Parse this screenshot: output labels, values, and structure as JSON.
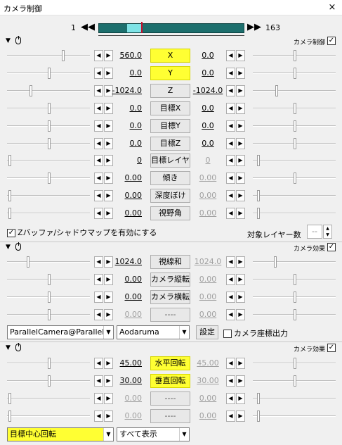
{
  "window": {
    "title": "カメラ制御",
    "close_label": "×"
  },
  "timeline": {
    "start": "1",
    "end": "163",
    "prev_label": "◀◀",
    "next_label": "▶▶"
  },
  "sections": [
    {
      "name": "カメラ制御",
      "checked": "✓"
    },
    {
      "name": "カメラ効果",
      "checked": "✓"
    },
    {
      "name": "カメラ効果",
      "checked": "✓"
    }
  ],
  "camera_control": {
    "params": [
      {
        "left": "560.0",
        "label": "X",
        "right": "0.0"
      },
      {
        "left": "0.0",
        "label": "Y",
        "right": "0.0"
      },
      {
        "left": "-1024.0",
        "label": "Z",
        "right": "-1024.0"
      },
      {
        "left": "0.0",
        "label": "目標X",
        "right": "0.0"
      },
      {
        "left": "0.0",
        "label": "目標Y",
        "right": "0.0"
      },
      {
        "left": "0.0",
        "label": "目標Z",
        "right": "0.0"
      },
      {
        "left": "0",
        "label": "目標レイヤ",
        "right": "0"
      },
      {
        "left": "0.00",
        "label": "傾き",
        "right": "0.00"
      },
      {
        "left": "0.00",
        "label": "深度ぼけ",
        "right": "0.00"
      },
      {
        "left": "0.00",
        "label": "視野角",
        "right": "0.00"
      }
    ],
    "zbuffer_label": "Zバッファ/シャドウマップを有効にする",
    "zbuffer_checked": "✓",
    "target_layer_label": "対象レイヤー数",
    "target_layer_value": "--"
  },
  "camera_effect1": {
    "params": [
      {
        "left": "1024.0",
        "label": "視線和",
        "right": "1024.0"
      },
      {
        "left": "0.00",
        "label": "カメラ縦転",
        "right": "0.00"
      },
      {
        "left": "0.00",
        "label": "カメラ横転",
        "right": "0.00"
      },
      {
        "left": "0.00",
        "label": "----",
        "right": "0.00"
      }
    ],
    "script_select": "ParallelCamera@ParallelC",
    "author_select": "Aodaruma",
    "settings_label": "設定",
    "output_label": "カメラ座標出力"
  },
  "camera_effect2": {
    "params": [
      {
        "left": "45.00",
        "label": "水平回転",
        "right": "45.00"
      },
      {
        "left": "30.00",
        "label": "垂直回転",
        "right": "30.00"
      },
      {
        "left": "0.00",
        "label": "----",
        "right": "0.00"
      },
      {
        "left": "0.00",
        "label": "----",
        "right": "0.00"
      }
    ],
    "mode_select": "目標中心回転",
    "display_select": "すべて表示"
  },
  "icons": {
    "arrow_left": "◀",
    "arrow_right": "▶",
    "dropdown": "▼",
    "collapse": "▼",
    "spin_up": "▲",
    "spin_down": "▼"
  },
  "colors": {
    "highlight": "#ffff33",
    "timeline": "#1d6f6d",
    "selection": "#7fe3e6",
    "marker": "#c8102e"
  }
}
